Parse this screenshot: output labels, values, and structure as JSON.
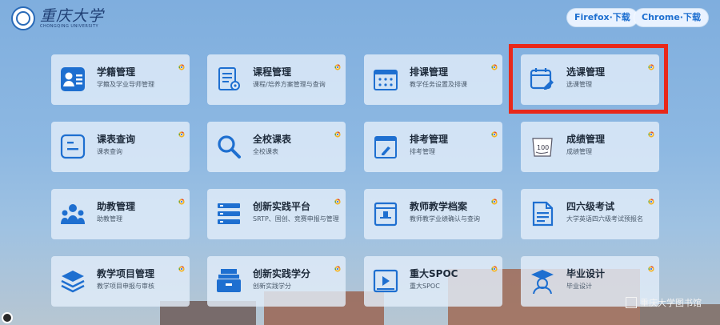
{
  "header": {
    "logo_text": "重庆大学",
    "logo_subtext": "CHONGQING UNIVERSITY",
    "download_firefox": "Firefox·下载",
    "download_chrome": "Chrome·下载"
  },
  "cards": [
    {
      "title": "学籍管理",
      "subtitle": "学籍及学业导师管理",
      "icon": "student-record-icon"
    },
    {
      "title": "课程管理",
      "subtitle": "课程/培养方案管理与查询",
      "icon": "course-document-icon"
    },
    {
      "title": "排课管理",
      "subtitle": "教学任务设置及排课",
      "icon": "schedule-grid-icon"
    },
    {
      "title": "选课管理",
      "subtitle": "选课管理",
      "icon": "calendar-edit-icon"
    },
    {
      "title": "课表查询",
      "subtitle": "课表查询",
      "icon": "timetable-icon"
    },
    {
      "title": "全校课表",
      "subtitle": "全校课表",
      "icon": "search-icon"
    },
    {
      "title": "排考管理",
      "subtitle": "排考管理",
      "icon": "exam-calendar-icon"
    },
    {
      "title": "成绩管理",
      "subtitle": "成绩管理",
      "icon": "grade-paper-icon"
    },
    {
      "title": "助教管理",
      "subtitle": "助教管理",
      "icon": "teaching-assistant-icon"
    },
    {
      "title": "创新实践平台",
      "subtitle": "SRTP、国创、竞赛申报与管理",
      "icon": "platform-list-icon"
    },
    {
      "title": "教师教学档案",
      "subtitle": "教师教学业绩确认与查询",
      "icon": "archive-folder-icon"
    },
    {
      "title": "四六级考试",
      "subtitle": "大学英语四六级考试预报名",
      "icon": "cet-exam-icon"
    },
    {
      "title": "教学项目管理",
      "subtitle": "教学项目申报与审核",
      "icon": "project-layers-icon"
    },
    {
      "title": "创新实践学分",
      "subtitle": "创新实践学分",
      "icon": "credit-box-icon"
    },
    {
      "title": "重大SPOC",
      "subtitle": "重大SPOC",
      "icon": "video-player-icon"
    },
    {
      "title": "毕业设计",
      "subtitle": "毕业设计",
      "icon": "graduation-icon"
    }
  ],
  "watermark": "重庆大学图书馆",
  "colors": {
    "accent": "#1e6fd0",
    "highlight": "#e8281a",
    "card_bg": "#e2edf9"
  }
}
